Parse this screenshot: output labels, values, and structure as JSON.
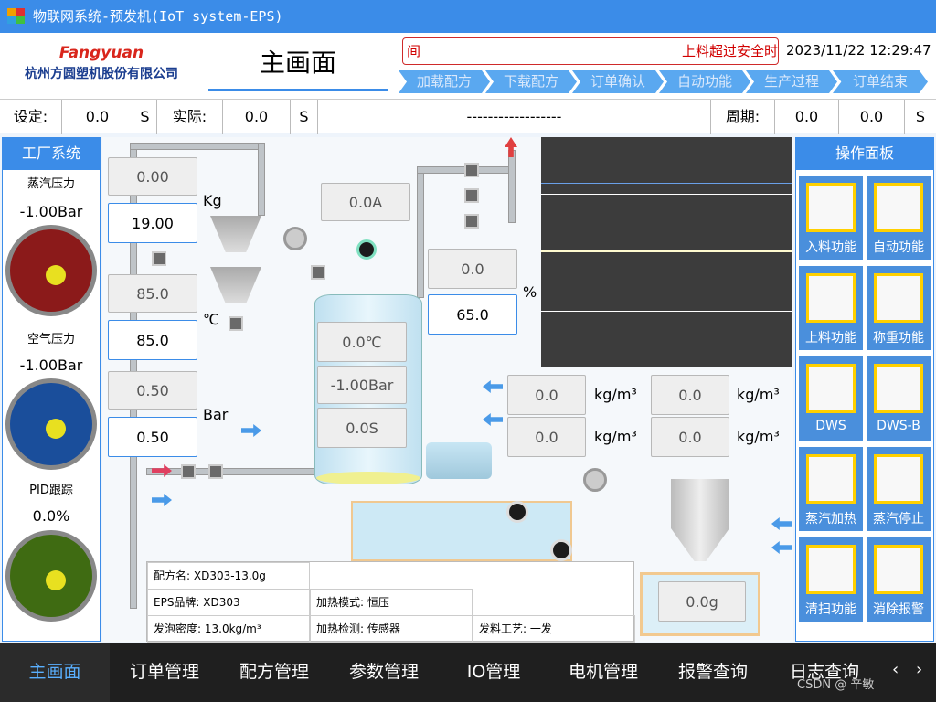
{
  "window": {
    "title": "物联网系统-预发机(IoT system-EPS)"
  },
  "brand": {
    "logo": "Fangyuan",
    "company": "杭州方圆塑机股份有限公司"
  },
  "header": {
    "page_title": "主画面",
    "alarm_left": "间",
    "alarm_right": "上料超过安全时",
    "datetime": "2023/11/22 12:29:47"
  },
  "steps": [
    "加载配方",
    "下载配方",
    "订单确认",
    "自动功能",
    "生产过程",
    "订单结束"
  ],
  "status": {
    "set_label": "设定:",
    "set_value": "0.0",
    "set_unit": "S",
    "actual_label": "实际:",
    "actual_value": "0.0",
    "actual_unit": "S",
    "dashes": "------------------",
    "cycle_label": "周期:",
    "cycle_v1": "0.0",
    "cycle_v2": "0.0",
    "cycle_unit": "S"
  },
  "factory": {
    "title": "工厂系统",
    "steam_label": "蒸汽压力",
    "steam_value": "-1.00Bar",
    "air_label": "空气压力",
    "air_value": "-1.00Bar",
    "pid_label": "PID跟踪",
    "pid_value": "0.0%",
    "gauge_colors": [
      "#8b1a1a",
      "#1a4e9b",
      "#3f6b12"
    ]
  },
  "process": {
    "weight_actual": "0.00",
    "weight_set": "19.00",
    "weight_unit": "Kg",
    "temp_actual": "85.0",
    "temp_set": "85.0",
    "temp_unit": "℃",
    "pressure_actual": "0.50",
    "pressure_set": "0.50",
    "pressure_unit": "Bar",
    "current": "0.0A",
    "level_actual": "0.0",
    "level_set": "65.0",
    "level_unit": "%",
    "tank_temp": "0.0℃",
    "tank_pressure": "-1.00Bar",
    "tank_time": "0.0S",
    "density1": "0.0",
    "density2": "0.0",
    "density3": "0.0",
    "density4": "0.0",
    "density_unit": "kg/m³",
    "bin_weight": "0.0g"
  },
  "recipe": {
    "name": "配方名: XD303-13.0g",
    "eps_brand": "EPS品牌: XD303",
    "heat_mode": "加热模式: 恒压",
    "density": "发泡密度: 13.0kg/m³",
    "heat_detect": "加热检测: 传感器",
    "process": "发料工艺: 一发"
  },
  "ops": {
    "title": "操作面板",
    "buttons": [
      {
        "label": "入料功能",
        "icon": "feed-icon"
      },
      {
        "label": "自动功能",
        "icon": "fan-icon"
      },
      {
        "label": "上料功能",
        "icon": "loader-icon"
      },
      {
        "label": "称重功能",
        "icon": "scale-icon"
      },
      {
        "label": "DWS",
        "icon": "dws-icon"
      },
      {
        "label": "DWS-B",
        "icon": "dws-b-icon"
      },
      {
        "label": "蒸汽加热",
        "icon": "steam-icon"
      },
      {
        "label": "蒸汽停止",
        "icon": "stop-icon"
      },
      {
        "label": "清扫功能",
        "icon": "broom-icon"
      },
      {
        "label": "消除报警",
        "icon": "reset-icon"
      }
    ]
  },
  "nav": [
    "主画面",
    "订单管理",
    "配方管理",
    "参数管理",
    "IO管理",
    "电机管理",
    "报警查询",
    "日志查询"
  ],
  "watermark": "CSDN @ 辛敏"
}
